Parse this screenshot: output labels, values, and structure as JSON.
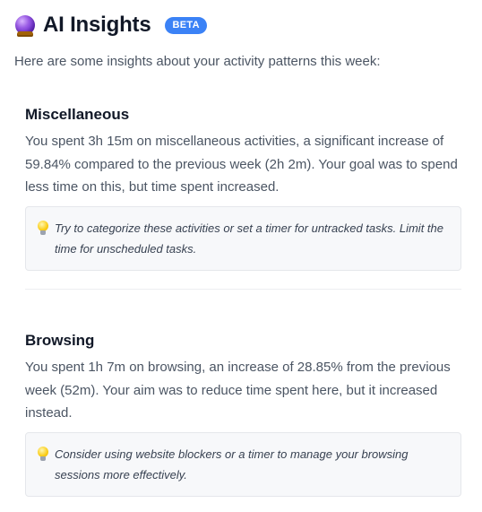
{
  "header": {
    "icon": "crystal-ball-icon",
    "title": "AI Insights",
    "badge": "BETA",
    "badge_color": "#3b82f6"
  },
  "intro": "Here are some insights about your activity patterns this week:",
  "insights": [
    {
      "title": "Miscellaneous",
      "description": "You spent 3h 15m on miscellaneous activities, a significant increase of 59.84% compared to the previous week (2h 2m). Your goal was to spend less time on this, but time spent increased.",
      "tip_icon": "lightbulb-icon",
      "tip": "Try to categorize these activities or set a timer for untracked tasks. Limit the time for unscheduled tasks."
    },
    {
      "title": "Browsing",
      "description": "You spent 1h 7m on browsing, an increase of 28.85% from the previous week (52m). Your aim was to reduce time spent here, but it increased instead.",
      "tip_icon": "lightbulb-icon",
      "tip": "Consider using website blockers or a timer to manage your browsing sessions more effectively."
    }
  ]
}
